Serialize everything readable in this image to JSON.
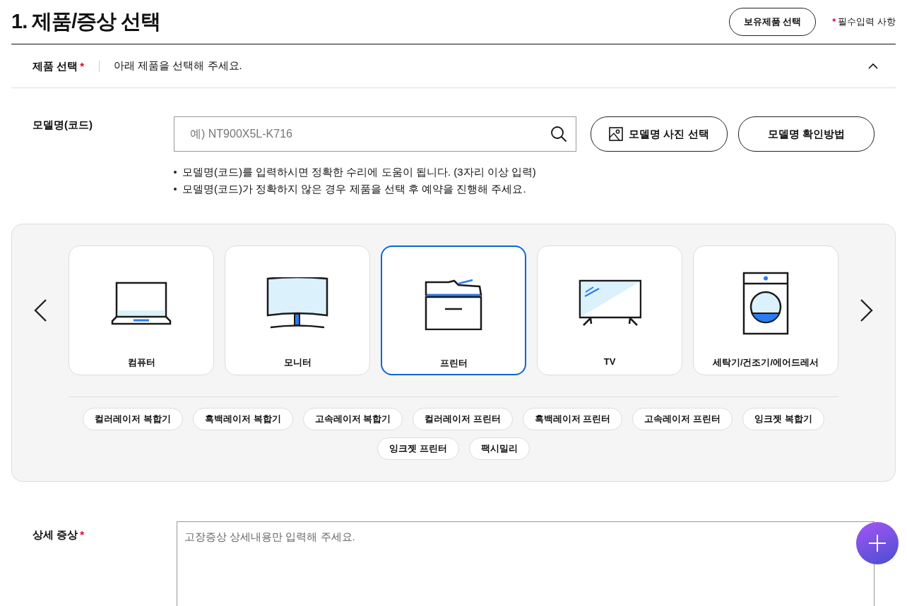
{
  "page_title": "1. 제품/증상 선택",
  "owned_products_button": "보유제품 선택",
  "required_note": {
    "mark": "*",
    "text": "필수입력 사항"
  },
  "product_select": {
    "label": "제품 선택",
    "mark": "*",
    "hint": "아래 제품을 선택해 주세요.",
    "expanded": true
  },
  "model": {
    "label": "모델명(코드)",
    "placeholder": "예) NT900X5L-K716",
    "photo_button": "모델명 사진 선택",
    "guide_button": "모델명 확인방법",
    "notes": [
      "모델명(코드)를 입력하시면 정확한 수리에 도움이 됩니다. (3자리 이상 입력)",
      "모델명(코드)가 정확하지 않은 경우 제품을 선택 후 예약을 진행해 주세요."
    ]
  },
  "categories": [
    {
      "kind": "laptop",
      "label": "컴퓨터",
      "selected": false
    },
    {
      "kind": "monitor",
      "label": "모니터",
      "selected": false
    },
    {
      "kind": "printer",
      "label": "프린터",
      "selected": true
    },
    {
      "kind": "tv",
      "label": "TV",
      "selected": false
    },
    {
      "kind": "washer",
      "label": "세탁기/건조기/에어드레서",
      "selected": false
    }
  ],
  "subcategories": [
    "컬러레이저 복합기",
    "흑백레이저 복합기",
    "고속레이저 복합기",
    "컬러레이저 프린터",
    "흑백레이저 프린터",
    "고속레이저 프린터",
    "잉크젯 복합기",
    "잉크젯 프린터",
    "팩시밀리"
  ],
  "symptom": {
    "label": "상세 증상",
    "mark": "*",
    "placeholder": "고장증상 상세내용만 입력해 주세요."
  }
}
